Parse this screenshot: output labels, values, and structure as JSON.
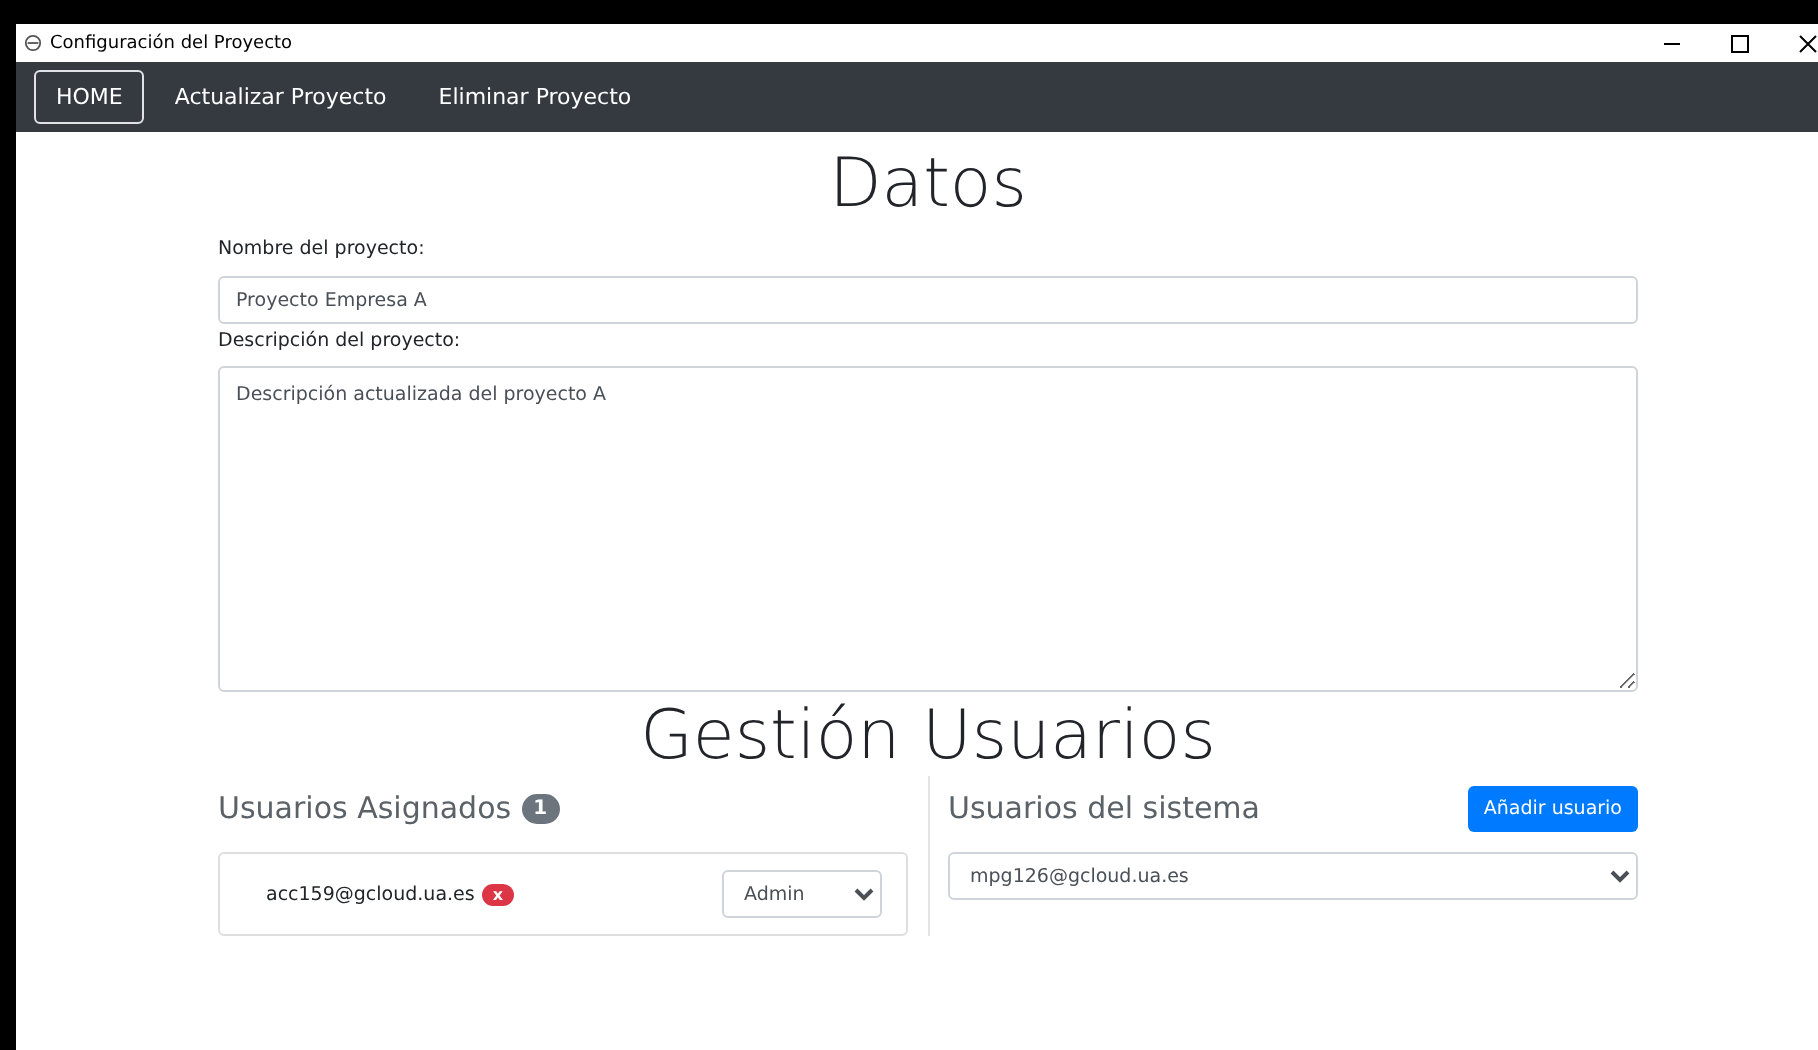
{
  "window": {
    "title": "Configuración del Proyecto"
  },
  "nav": [
    {
      "label": "HOME",
      "selected": true
    },
    {
      "label": "Actualizar Proyecto",
      "selected": false
    },
    {
      "label": "Eliminar Proyecto",
      "selected": false
    }
  ],
  "datos": {
    "heading": "Datos",
    "name_label": "Nombre del proyecto:",
    "name_value": "Proyecto Empresa A",
    "desc_label": "Descripción del proyecto:",
    "desc_value": "Descripción actualizada del proyecto A"
  },
  "gestion": {
    "heading": "Gestión Usuarios",
    "assigned": {
      "title": "Usuarios Asignados",
      "count": "1",
      "users": [
        {
          "email": "acc159@gcloud.ua.es",
          "remove": "x",
          "role": "Admin"
        }
      ]
    },
    "system": {
      "title": "Usuarios del sistema",
      "add_button": "Añadir usuario",
      "selected_user": "mpg126@gcloud.ua.es"
    }
  }
}
